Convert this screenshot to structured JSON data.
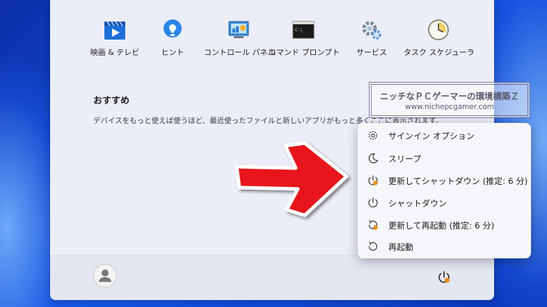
{
  "pinned_apps": [
    {
      "label": "映画 & テレビ",
      "icon": "movies-tv-icon"
    },
    {
      "label": "ヒント",
      "icon": "tips-icon"
    },
    {
      "label": "コントロール パネル",
      "icon": "control-panel-icon"
    },
    {
      "label": "コマンド プロンプト",
      "icon": "command-prompt-icon"
    },
    {
      "label": "サービス",
      "icon": "services-icon"
    },
    {
      "label": "タスク スケジューラ",
      "icon": "task-scheduler-icon"
    }
  ],
  "recommended": {
    "title": "おすすめ",
    "description": "デバイスをもっと使えば使うほど、最近使ったファイルと新しいアプリがもっと多くここに表示されます。"
  },
  "power_menu": {
    "items": [
      {
        "label": "サインイン オプション",
        "icon": "gear-icon"
      },
      {
        "label": "スリープ",
        "icon": "moon-icon"
      },
      {
        "label": "更新してシャットダウン (推定: 6 分)",
        "icon": "update-shutdown-icon"
      },
      {
        "label": "シャットダウン",
        "icon": "power-icon"
      },
      {
        "label": "更新して再起動 (推定: 6 分)",
        "icon": "update-restart-icon"
      },
      {
        "label": "再起動",
        "icon": "restart-icon"
      }
    ]
  },
  "watermark": {
    "line1": "ニッチなＰＣゲーマーの環境構築Ｚ",
    "line2": "www.nichepcgamer.com"
  },
  "colors": {
    "accent_orange": "#f08a1c",
    "arrow_red": "#e8141b"
  }
}
